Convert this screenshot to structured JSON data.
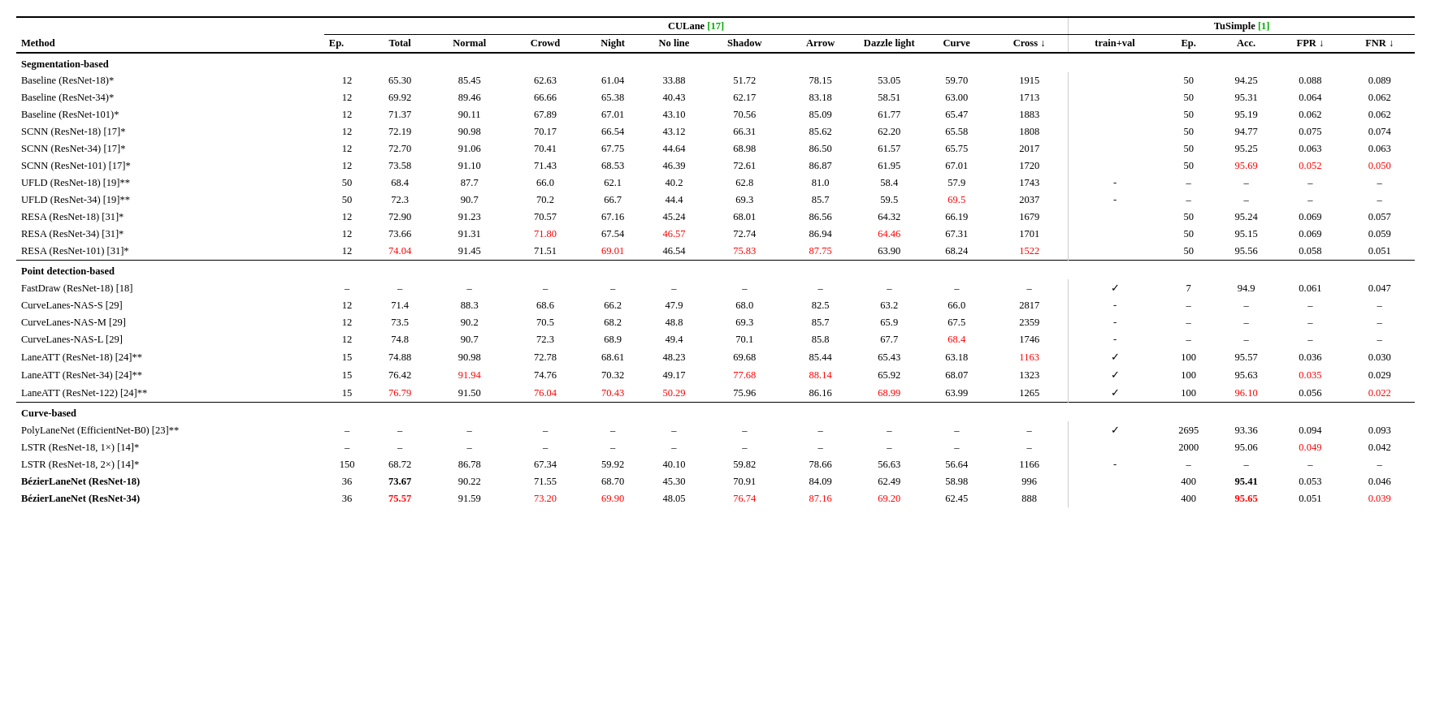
{
  "table": {
    "culane_header": "CULane",
    "culane_ref": "[17]",
    "tusimple_header": "TuSimple",
    "tusimple_ref": "[1]",
    "columns": {
      "method": "Method",
      "ep": "Ep.",
      "total": "Total",
      "normal": "Normal",
      "crowd": "Crowd",
      "night": "Night",
      "noline": "No line",
      "shadow": "Shadow",
      "arrow": "Arrow",
      "dazzle": "Dazzle light",
      "curve": "Curve",
      "cross": "Cross ↓",
      "trainval": "train+val",
      "ep2": "Ep.",
      "acc": "Acc.",
      "fpr": "FPR ↓",
      "fnr": "FNR ↓"
    },
    "sections": [
      {
        "title": "Segmentation-based",
        "rows": [
          {
            "method": "Baseline (ResNet-18)*",
            "ep": "12",
            "total": "65.30",
            "normal": "85.45",
            "crowd": "62.63",
            "night": "61.04",
            "noline": "33.88",
            "shadow": "51.72",
            "arrow": "78.15",
            "dazzle": "53.05",
            "curve": "59.70",
            "cross": "1915",
            "trainval": "",
            "ep2": "50",
            "acc": "94.25",
            "fpr": "0.088",
            "fnr": "0.089",
            "total_red": false,
            "normal_red": false,
            "crowd_red": false,
            "night_red": false,
            "noline_red": false,
            "shadow_red": false,
            "arrow_red": false,
            "dazzle_red": false,
            "curve_red": false,
            "cross_red": false,
            "acc_red": false,
            "fpr_red": false,
            "fnr_red": false,
            "method_bold": false
          },
          {
            "method": "Baseline (ResNet-34)*",
            "ep": "12",
            "total": "69.92",
            "normal": "89.46",
            "crowd": "66.66",
            "night": "65.38",
            "noline": "40.43",
            "shadow": "62.17",
            "arrow": "83.18",
            "dazzle": "58.51",
            "curve": "63.00",
            "cross": "1713",
            "trainval": "",
            "ep2": "50",
            "acc": "95.31",
            "fpr": "0.064",
            "fnr": "0.062",
            "method_bold": false
          },
          {
            "method": "Baseline (ResNet-101)*",
            "ep": "12",
            "total": "71.37",
            "normal": "90.11",
            "crowd": "67.89",
            "night": "67.01",
            "noline": "43.10",
            "shadow": "70.56",
            "arrow": "85.09",
            "dazzle": "61.77",
            "curve": "65.47",
            "cross": "1883",
            "trainval": "",
            "ep2": "50",
            "acc": "95.19",
            "fpr": "0.062",
            "fnr": "0.062",
            "method_bold": false
          },
          {
            "method": "SCNN (ResNet-18) [17]*",
            "ep": "12",
            "total": "72.19",
            "normal": "90.98",
            "crowd": "70.17",
            "night": "66.54",
            "noline": "43.12",
            "shadow": "66.31",
            "arrow": "85.62",
            "dazzle": "62.20",
            "curve": "65.58",
            "cross": "1808",
            "trainval": "",
            "ep2": "50",
            "acc": "94.77",
            "fpr": "0.075",
            "fnr": "0.074",
            "method_bold": false
          },
          {
            "method": "SCNN (ResNet-34) [17]*",
            "ep": "12",
            "total": "72.70",
            "normal": "91.06",
            "crowd": "70.41",
            "night": "67.75",
            "noline": "44.64",
            "shadow": "68.98",
            "arrow": "86.50",
            "dazzle": "61.57",
            "curve": "65.75",
            "cross": "2017",
            "trainval": "",
            "ep2": "50",
            "acc": "95.25",
            "fpr": "0.063",
            "fnr": "0.063",
            "method_bold": false
          },
          {
            "method": "SCNN (ResNet-101) [17]*",
            "ep": "12",
            "total": "73.58",
            "normal": "91.10",
            "crowd": "71.43",
            "night": "68.53",
            "noline": "46.39",
            "shadow": "72.61",
            "arrow": "86.87",
            "dazzle": "61.95",
            "curve": "67.01",
            "cross": "1720",
            "trainval": "",
            "ep2": "50",
            "acc": "95.69",
            "fpr": "0.052",
            "fnr": "0.050",
            "acc_red": true,
            "fpr_red": true,
            "fnr_red": true,
            "method_bold": false
          },
          {
            "method": "UFLD (ResNet-18) [19]**",
            "ep": "50",
            "total": "68.4",
            "normal": "87.7",
            "crowd": "66.0",
            "night": "62.1",
            "noline": "40.2",
            "shadow": "62.8",
            "arrow": "81.0",
            "dazzle": "58.4",
            "curve": "57.9",
            "cross": "1743",
            "trainval": "-",
            "ep2": "–",
            "acc": "–",
            "fpr": "–",
            "fnr": "–",
            "method_bold": false
          },
          {
            "method": "UFLD (ResNet-34) [19]**",
            "ep": "50",
            "total": "72.3",
            "normal": "90.7",
            "crowd": "70.2",
            "night": "66.7",
            "noline": "44.4",
            "shadow": "69.3",
            "arrow": "85.7",
            "dazzle": "59.5",
            "curve": "69.5",
            "cross": "2037",
            "trainval": "-",
            "ep2": "–",
            "acc": "–",
            "fpr": "–",
            "fnr": "–",
            "curve_red": true,
            "method_bold": false
          },
          {
            "method": "RESA (ResNet-18) [31]*",
            "ep": "12",
            "total": "72.90",
            "normal": "91.23",
            "crowd": "70.57",
            "night": "67.16",
            "noline": "45.24",
            "shadow": "68.01",
            "arrow": "86.56",
            "dazzle": "64.32",
            "curve": "66.19",
            "cross": "1679",
            "trainval": "",
            "ep2": "50",
            "acc": "95.24",
            "fpr": "0.069",
            "fnr": "0.057",
            "method_bold": false
          },
          {
            "method": "RESA (ResNet-34) [31]*",
            "ep": "12",
            "total": "73.66",
            "normal": "91.31",
            "crowd": "71.80",
            "night": "67.54",
            "noline": "46.57",
            "shadow": "72.74",
            "arrow": "86.94",
            "dazzle": "64.46",
            "curve": "67.31",
            "cross": "1701",
            "trainval": "",
            "ep2": "50",
            "acc": "95.15",
            "fpr": "0.069",
            "fnr": "0.059",
            "crowd_red": true,
            "noline_red": true,
            "dazzle_red": true,
            "method_bold": false
          },
          {
            "method": "RESA (ResNet-101) [31]*",
            "ep": "12",
            "total": "74.04",
            "normal": "91.45",
            "crowd": "71.51",
            "night": "69.01",
            "noline": "46.54",
            "shadow": "75.83",
            "arrow": "87.75",
            "dazzle": "63.90",
            "curve": "68.24",
            "cross": "1522",
            "trainval": "",
            "ep2": "50",
            "acc": "95.56",
            "fpr": "0.058",
            "fnr": "0.051",
            "total_red": true,
            "night_red": true,
            "shadow_red": true,
            "arrow_red": true,
            "cross_red": true,
            "method_bold": false
          }
        ]
      },
      {
        "title": "Point detection-based",
        "rows": [
          {
            "method": "FastDraw (ResNet-18) [18]",
            "ep": "–",
            "total": "–",
            "normal": "–",
            "crowd": "–",
            "night": "–",
            "noline": "–",
            "shadow": "–",
            "arrow": "–",
            "dazzle": "–",
            "curve": "–",
            "cross": "–",
            "trainval": "✓",
            "ep2": "7",
            "acc": "94.9",
            "fpr": "0.061",
            "fnr": "0.047",
            "method_bold": false
          },
          {
            "method": "CurveLanes-NAS-S [29]",
            "ep": "12",
            "total": "71.4",
            "normal": "88.3",
            "crowd": "68.6",
            "night": "66.2",
            "noline": "47.9",
            "shadow": "68.0",
            "arrow": "82.5",
            "dazzle": "63.2",
            "curve": "66.0",
            "cross": "2817",
            "trainval": "-",
            "ep2": "–",
            "acc": "–",
            "fpr": "–",
            "fnr": "–",
            "method_bold": false
          },
          {
            "method": "CurveLanes-NAS-M [29]",
            "ep": "12",
            "total": "73.5",
            "normal": "90.2",
            "crowd": "70.5",
            "night": "68.2",
            "noline": "48.8",
            "shadow": "69.3",
            "arrow": "85.7",
            "dazzle": "65.9",
            "curve": "67.5",
            "cross": "2359",
            "trainval": "-",
            "ep2": "–",
            "acc": "–",
            "fpr": "–",
            "fnr": "–",
            "method_bold": false
          },
          {
            "method": "CurveLanes-NAS-L [29]",
            "ep": "12",
            "total": "74.8",
            "normal": "90.7",
            "crowd": "72.3",
            "night": "68.9",
            "noline": "49.4",
            "shadow": "70.1",
            "arrow": "85.8",
            "dazzle": "67.7",
            "curve": "68.4",
            "cross": "1746",
            "trainval": "-",
            "ep2": "–",
            "acc": "–",
            "fpr": "–",
            "fnr": "–",
            "curve_red": true,
            "method_bold": false
          },
          {
            "method": "LaneATT (ResNet-18) [24]**",
            "ep": "15",
            "total": "74.88",
            "normal": "90.98",
            "crowd": "72.78",
            "night": "68.61",
            "noline": "48.23",
            "shadow": "69.68",
            "arrow": "85.44",
            "dazzle": "65.43",
            "curve": "63.18",
            "cross": "1163",
            "trainval": "✓",
            "ep2": "100",
            "acc": "95.57",
            "fpr": "0.036",
            "fnr": "0.030",
            "cross_red": true,
            "method_bold": false
          },
          {
            "method": "LaneATT (ResNet-34) [24]**",
            "ep": "15",
            "total": "76.42",
            "normal": "91.94",
            "crowd": "74.76",
            "night": "70.32",
            "noline": "49.17",
            "shadow": "77.68",
            "arrow": "88.14",
            "dazzle": "65.92",
            "curve": "68.07",
            "cross": "1323",
            "trainval": "✓",
            "ep2": "100",
            "acc": "95.63",
            "fpr": "0.035",
            "fnr": "0.029",
            "normal_red": true,
            "shadow_red": true,
            "arrow_red": true,
            "fpr_red": true,
            "method_bold": false
          },
          {
            "method": "LaneATT (ResNet-122) [24]**",
            "ep": "15",
            "total": "76.79",
            "normal": "91.50",
            "crowd": "76.04",
            "night": "70.43",
            "noline": "50.29",
            "shadow": "75.96",
            "arrow": "86.16",
            "dazzle": "68.99",
            "curve": "63.99",
            "cross": "1265",
            "trainval": "✓",
            "ep2": "100",
            "acc": "96.10",
            "fpr": "0.056",
            "fnr": "0.022",
            "total_red": true,
            "crowd_red": true,
            "night_red": true,
            "noline_red": true,
            "dazzle_red": true,
            "acc_red": true,
            "fnr_red": true,
            "method_bold": false
          }
        ]
      },
      {
        "title": "Curve-based",
        "rows": [
          {
            "method": "PolyLaneNet (EfficientNet-B0) [23]**",
            "ep": "–",
            "total": "–",
            "normal": "–",
            "crowd": "–",
            "night": "–",
            "noline": "–",
            "shadow": "–",
            "arrow": "–",
            "dazzle": "–",
            "curve": "–",
            "cross": "–",
            "trainval": "✓",
            "ep2": "2695",
            "acc": "93.36",
            "fpr": "0.094",
            "fnr": "0.093",
            "method_bold": false
          },
          {
            "method": "LSTR (ResNet-18, 1×) [14]*",
            "ep": "–",
            "total": "–",
            "normal": "–",
            "crowd": "–",
            "night": "–",
            "noline": "–",
            "shadow": "–",
            "arrow": "–",
            "dazzle": "–",
            "curve": "–",
            "cross": "–",
            "trainval": "",
            "ep2": "2000",
            "acc": "95.06",
            "fpr": "0.049",
            "fnr": "0.042",
            "fpr_red": true,
            "method_bold": false
          },
          {
            "method": "LSTR (ResNet-18, 2×) [14]*",
            "ep": "150",
            "total": "68.72",
            "normal": "86.78",
            "crowd": "67.34",
            "night": "59.92",
            "noline": "40.10",
            "shadow": "59.82",
            "arrow": "78.66",
            "dazzle": "56.63",
            "curve": "56.64",
            "cross": "1166",
            "trainval": "-",
            "ep2": "–",
            "acc": "–",
            "fpr": "–",
            "fnr": "–",
            "method_bold": false
          },
          {
            "method": "BézierLaneNet (ResNet-18)",
            "ep": "36",
            "total": "73.67",
            "normal": "90.22",
            "crowd": "71.55",
            "night": "68.70",
            "noline": "45.30",
            "shadow": "70.91",
            "arrow": "84.09",
            "dazzle": "62.49",
            "curve": "58.98",
            "cross": "996",
            "trainval": "",
            "ep2": "400",
            "acc": "95.41",
            "fpr": "0.053",
            "fnr": "0.046",
            "method_bold": true
          },
          {
            "method": "BézierLaneNet (ResNet-34)",
            "ep": "36",
            "total": "75.57",
            "normal": "91.59",
            "crowd": "73.20",
            "night": "69.90",
            "noline": "48.05",
            "shadow": "76.74",
            "arrow": "87.16",
            "dazzle": "69.20",
            "curve": "62.45",
            "cross": "888",
            "trainval": "",
            "ep2": "400",
            "acc": "95.65",
            "fpr": "0.051",
            "fnr": "0.039",
            "total_red": true,
            "crowd_red": true,
            "night_red": true,
            "shadow_red": true,
            "arrow_red": true,
            "dazzle_red": true,
            "acc_red": true,
            "fnr_red": true,
            "method_bold": true
          }
        ]
      }
    ]
  }
}
